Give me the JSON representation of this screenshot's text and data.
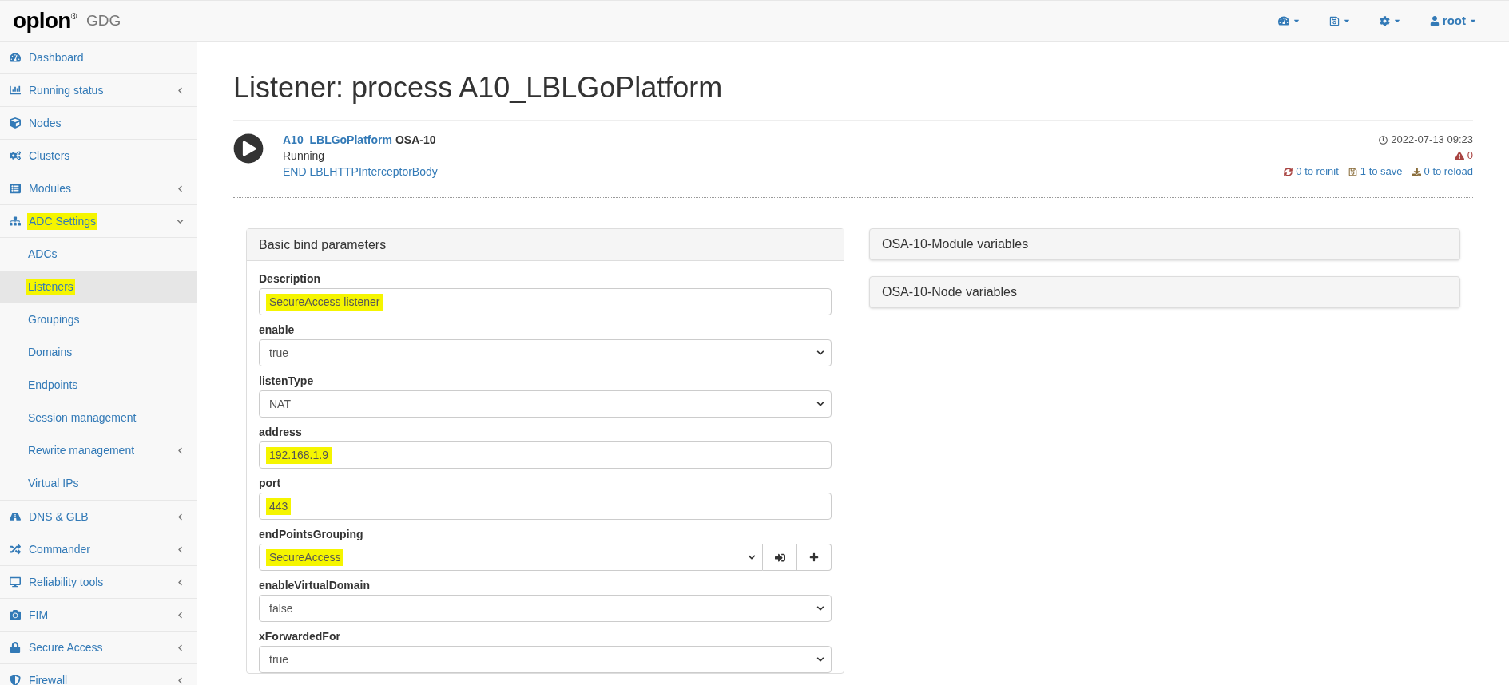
{
  "brand": {
    "logo": "oplon",
    "mark": "®",
    "product": "GDG"
  },
  "topbar": {
    "user": "root"
  },
  "sidebar": {
    "items": [
      {
        "label": "Dashboard",
        "selected": false,
        "highlighted": false
      },
      {
        "label": "Running status",
        "expanded": false,
        "selected": false,
        "highlighted": false
      },
      {
        "label": "Nodes",
        "selected": false,
        "highlighted": false
      },
      {
        "label": "Clusters",
        "selected": false,
        "highlighted": false
      },
      {
        "label": "Modules",
        "expanded": false,
        "selected": false,
        "highlighted": false
      },
      {
        "label": "ADC Settings",
        "expanded": true,
        "selected": false,
        "highlighted": true,
        "children": [
          {
            "label": "ADCs",
            "selected": false,
            "highlighted": false
          },
          {
            "label": "Listeners",
            "selected": true,
            "highlighted": true
          },
          {
            "label": "Groupings",
            "selected": false,
            "highlighted": false
          },
          {
            "label": "Domains",
            "selected": false,
            "highlighted": false
          },
          {
            "label": "Endpoints",
            "selected": false,
            "highlighted": false
          },
          {
            "label": "Session management",
            "selected": false,
            "highlighted": false
          },
          {
            "label": "Rewrite management",
            "expanded": false,
            "selected": false,
            "highlighted": false
          },
          {
            "label": "Virtual IPs",
            "selected": false,
            "highlighted": false
          }
        ]
      },
      {
        "label": "DNS & GLB",
        "expanded": false,
        "selected": false,
        "highlighted": false
      },
      {
        "label": "Commander",
        "expanded": false,
        "selected": false,
        "highlighted": false
      },
      {
        "label": "Reliability tools",
        "expanded": false,
        "selected": false,
        "highlighted": false
      },
      {
        "label": "FIM",
        "expanded": false,
        "selected": false,
        "highlighted": false
      },
      {
        "label": "Secure Access",
        "expanded": false,
        "selected": false,
        "highlighted": false
      },
      {
        "label": "Firewall",
        "expanded": false,
        "selected": false,
        "highlighted": false
      }
    ]
  },
  "page_title": "Listener: process A10_LBLGoPlatform",
  "process": {
    "name": "A10_LBLGoPlatform",
    "node": "OSA-10",
    "status": "Running",
    "detail": "END LBLHTTPInterceptorBody",
    "timestamp": "2022-07-13 09:23",
    "warnings": "0",
    "reinit": "0 to reinit",
    "save": "1 to save",
    "reload": "0 to reload"
  },
  "bind_panel": {
    "title": "Basic bind parameters",
    "fields": [
      {
        "kind": "text",
        "label": "Description",
        "value": "SecureAccess listener",
        "highlighted": true
      },
      {
        "kind": "select",
        "label": "enable",
        "value": "true",
        "highlighted": false
      },
      {
        "kind": "select",
        "label": "listenType",
        "value": "NAT",
        "highlighted": false
      },
      {
        "kind": "text",
        "label": "address",
        "value": "192.168.1.9",
        "highlighted": true
      },
      {
        "kind": "text",
        "label": "port",
        "value": "443",
        "highlighted": true
      },
      {
        "kind": "select-buttons",
        "label": "endPointsGrouping",
        "value": "SecureAccess",
        "highlighted": true
      },
      {
        "kind": "select",
        "label": "enableVirtualDomain",
        "value": "false",
        "highlighted": false
      },
      {
        "kind": "select",
        "label": "xForwardedFor",
        "value": "true",
        "highlighted": false
      }
    ]
  },
  "side_panels": [
    {
      "title": "OSA-10-Module variables"
    },
    {
      "title": "OSA-10-Node variables"
    }
  ]
}
